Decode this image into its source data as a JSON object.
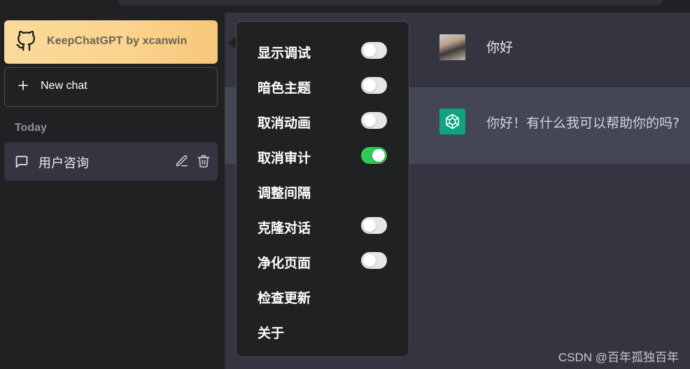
{
  "brand": {
    "title": "KeepChatGPT by xcanwin"
  },
  "sidebar": {
    "new_chat_label": "New chat",
    "section_label": "Today",
    "chats": [
      {
        "title": "用户咨询"
      }
    ]
  },
  "conversation": {
    "user_message": "你好",
    "assistant_message": "你好！有什么我可以帮助你的吗?"
  },
  "menu": {
    "items": [
      {
        "label": "显示调试",
        "has_toggle": true,
        "on": false
      },
      {
        "label": "暗色主题",
        "has_toggle": true,
        "on": false
      },
      {
        "label": "取消动画",
        "has_toggle": true,
        "on": false
      },
      {
        "label": "取消审计",
        "has_toggle": true,
        "on": true
      },
      {
        "label": "调整间隔",
        "has_toggle": false
      },
      {
        "label": "克隆对话",
        "has_toggle": true,
        "on": false
      },
      {
        "label": "净化页面",
        "has_toggle": true,
        "on": false
      },
      {
        "label": "检查更新",
        "has_toggle": false
      },
      {
        "label": "关于",
        "has_toggle": false
      }
    ]
  },
  "watermark": "CSDN @百年孤独百年",
  "colors": {
    "brand_gradient_start": "#f9db9a",
    "toggle_on": "#34c759",
    "toggle_off": "#e6e6e6",
    "assistant_avatar": "#10a37f",
    "sidebar_bg": "#202123",
    "main_bg": "#343541",
    "assistant_row_bg": "#444654"
  },
  "icons": {
    "brand": "github-icon",
    "new_chat": "plus-icon",
    "chat": "message-square-icon",
    "edit": "pencil-icon",
    "delete": "trash-icon",
    "assistant": "openai-logo-icon"
  }
}
